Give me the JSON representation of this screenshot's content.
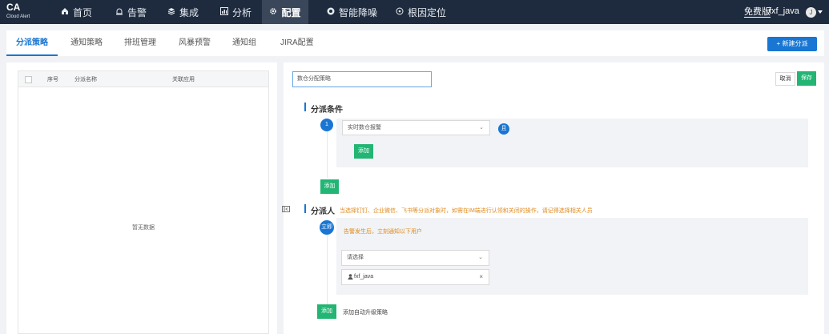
{
  "brand": {
    "name": "CA",
    "subtitle": "Cloud Alert"
  },
  "nav": {
    "home": {
      "label": "首页",
      "icon": "home-icon"
    },
    "alerts": {
      "label": "告警",
      "icon": "alarm-icon"
    },
    "integration": {
      "label": "集成",
      "icon": "layers-icon"
    },
    "analysis": {
      "label": "分析",
      "icon": "chart-icon"
    },
    "config": {
      "label": "配置",
      "icon": "gear-icon"
    },
    "noise": {
      "label": "智能降噪",
      "icon": "noise-icon"
    },
    "rca": {
      "label": "根因定位",
      "icon": "target-icon"
    }
  },
  "header_right": {
    "plan": "免费版",
    "user": "fxf_java",
    "avatar_initial": "J"
  },
  "tabs": {
    "dispatch": "分派策略",
    "notify_policy": "通知策略",
    "schedule": "排班管理",
    "storm": "风暴预警",
    "notify_group": "通知组",
    "jira": "JIRA配置"
  },
  "new_button": "+ 新建分派",
  "table": {
    "columns": {
      "index": "序号",
      "name": "分派名称",
      "app": "关联应用"
    },
    "empty_text": "暂无数据"
  },
  "form": {
    "name_value": "数仓分配策略",
    "cancel": "取消",
    "save": "保存",
    "conditions": {
      "title": "分派条件",
      "step": "1",
      "select_value": "实时数仓报警",
      "and_label": "且",
      "inner_add": "添加",
      "add": "添加"
    },
    "assignee": {
      "title": "分派人",
      "notice": "当选择钉钉、企业微信、飞书等分派对象时，如需在IM端进行认领和关闭的操作，请记得选择相关人员",
      "step": "立即",
      "sub_notice": "告警发生后，立刻通知以下用户",
      "select_placeholder": "请选择",
      "selected_user": "fxf_java",
      "add": "添加",
      "escalate_label": "添加自动升级策略"
    }
  },
  "colors": {
    "topbar": "#1e2b3e",
    "accent": "#1976d2",
    "green": "#22b573",
    "warning": "#e08a1e"
  }
}
